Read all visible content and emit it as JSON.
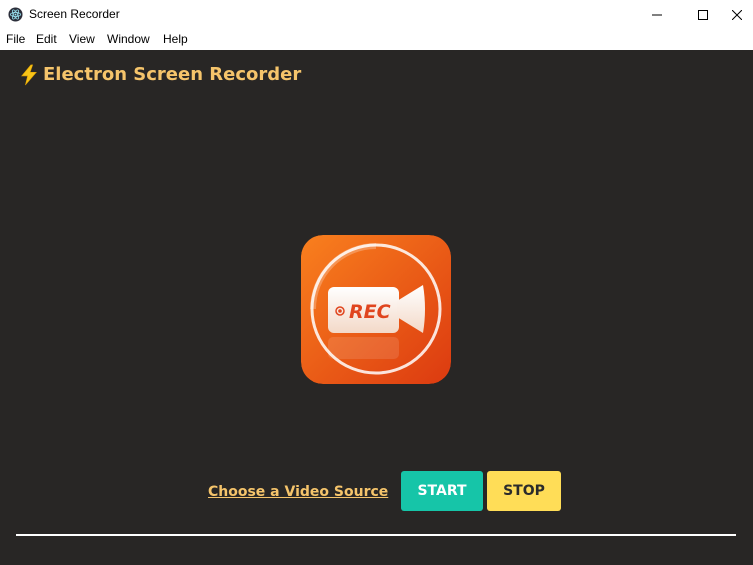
{
  "window": {
    "title": "Screen Recorder"
  },
  "menu": {
    "items": [
      "File",
      "Edit",
      "View",
      "Window",
      "Help"
    ]
  },
  "app": {
    "title": "Electron Screen Recorder",
    "logo_text": "REC",
    "choose_source_label": "Choose a Video Source",
    "start_label": "START",
    "stop_label": "STOP"
  },
  "colors": {
    "background": "#282625",
    "title_accent": "#f5c46b",
    "start_button": "#16c5a8",
    "stop_button": "#ffdd57",
    "logo_gradient_start": "#f9801e",
    "logo_gradient_end": "#dc3a10"
  },
  "icons": {
    "app": "electron-app-icon",
    "title_prefix": "lightning-bolt-icon",
    "minimize": "minimize-icon",
    "maximize": "maximize-icon",
    "close": "close-icon"
  }
}
